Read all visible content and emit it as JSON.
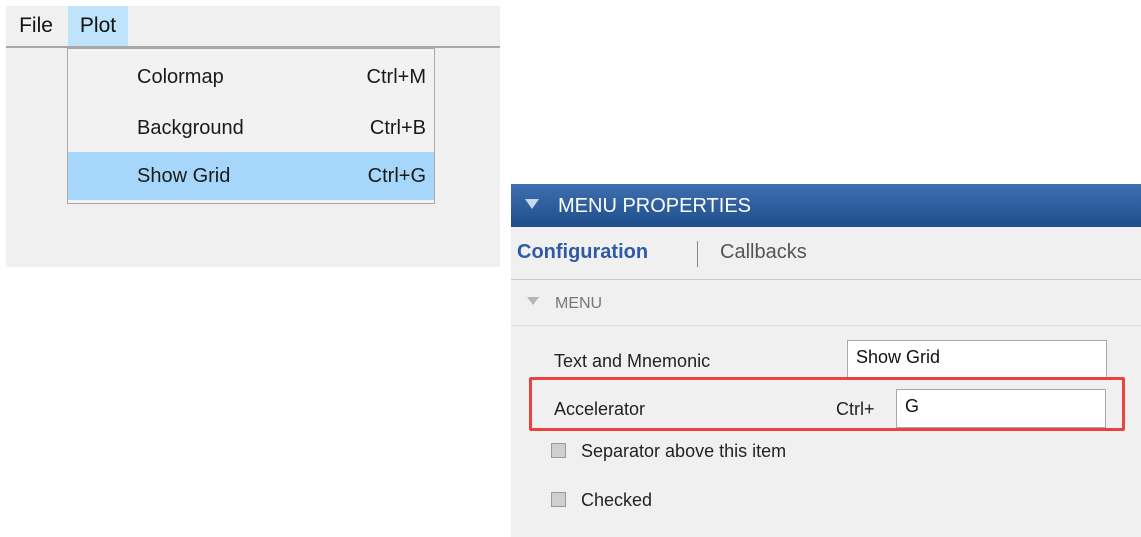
{
  "menubar": {
    "items": [
      {
        "label": "File"
      },
      {
        "label": "Plot"
      }
    ]
  },
  "dropdown": {
    "items": [
      {
        "label": "Colormap",
        "shortcut": "Ctrl+M"
      },
      {
        "label": "Background",
        "shortcut": "Ctrl+B"
      },
      {
        "label": "Show Grid",
        "shortcut": "Ctrl+G"
      }
    ]
  },
  "inspector": {
    "header_title": "MENU PROPERTIES",
    "tabs": [
      {
        "label": "Configuration",
        "active": true
      },
      {
        "label": "Callbacks",
        "active": false
      }
    ],
    "section_title": "MENU",
    "properties": {
      "text_label": "Text and Mnemonic",
      "text_value": "Show Grid",
      "accel_label": "Accelerator",
      "accel_prefix": "Ctrl+",
      "accel_value": "G"
    },
    "checkboxes": [
      {
        "label": "Separator above this item",
        "checked": false
      },
      {
        "label": "Checked",
        "checked": false
      }
    ]
  },
  "colors": {
    "menu_highlight": "#a6d7fa",
    "header_blue": "#1f4e8c",
    "annotation_red": "#e8433f",
    "tab_active": "#2f5aa6"
  },
  "icons": [
    "collapse-triangle-icon",
    "section-triangle-icon"
  ]
}
